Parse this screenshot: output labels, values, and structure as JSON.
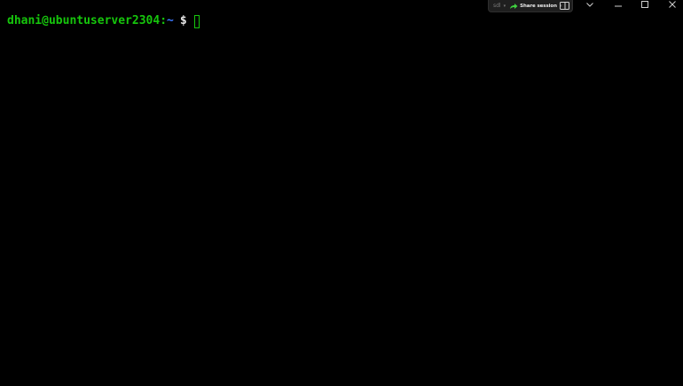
{
  "terminal": {
    "prompt": {
      "user_host": "dhani@ubuntuserver2304",
      "separator": ":",
      "path": "~",
      "symbol": "$"
    }
  },
  "titlebar": {
    "session_user": "sdl",
    "share_label": "Share session",
    "icons": [
      "share-arrow-icon",
      "split-pane-icon",
      "chevron-down-icon",
      "minimize-icon",
      "maximize-icon",
      "close-icon"
    ]
  },
  "colors": {
    "background": "#000000",
    "prompt_green": "#16c60c",
    "path_blue": "#3b78ff",
    "text": "#e6e6e6"
  }
}
